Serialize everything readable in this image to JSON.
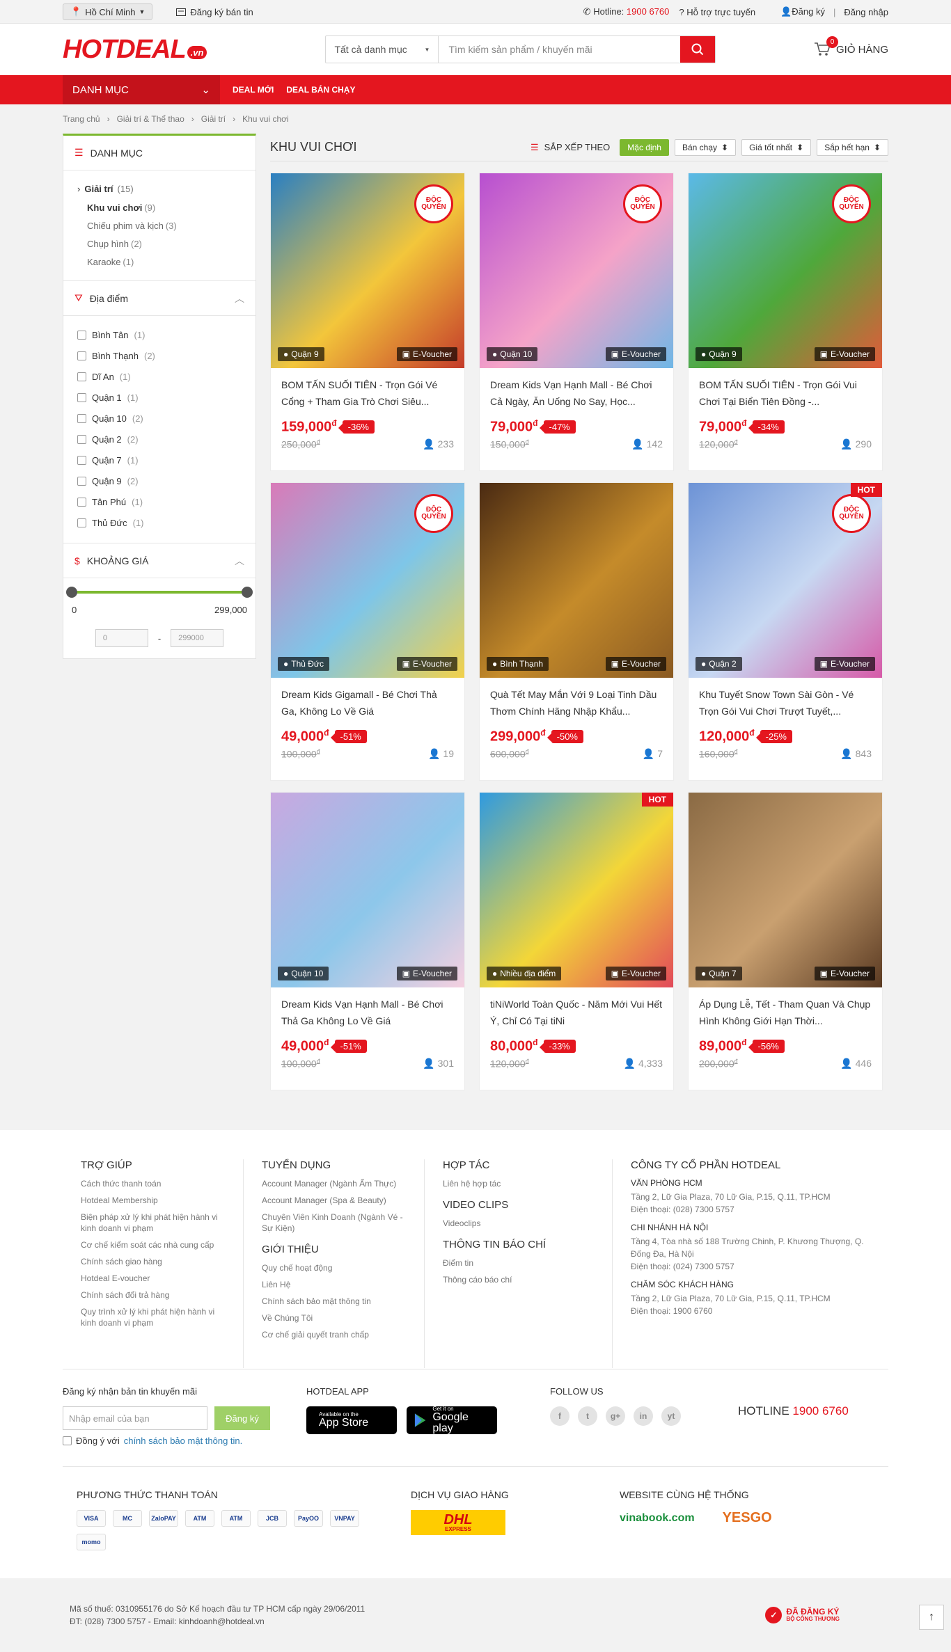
{
  "topbar": {
    "city": "Hồ Chí Minh",
    "register_seller": "Đăng ký bán tin",
    "hotline_label": "Hotline:",
    "hotline_number": "1900 6760",
    "online_support": "Hỗ trợ trực tuyến",
    "register": "Đăng ký",
    "separator": "|",
    "login": "Đăng nhập"
  },
  "header": {
    "logo": "HOTDEAL",
    "logo_suffix": ".vn",
    "category_select": "Tất cả danh mục",
    "search_placeholder": "Tìm kiếm sản phẩm / khuyến mãi",
    "cart_label": "GIỎ HÀNG",
    "cart_count": "0"
  },
  "nav": {
    "category_label": "DANH MỤC",
    "items": [
      "DEAL MỚI",
      "DEAL BÁN CHẠY"
    ]
  },
  "breadcrumb": [
    "Trang chủ",
    "Giải trí & Thể thao",
    "Giải trí",
    "Khu vui chơi"
  ],
  "sidebar": {
    "categories_title": "DANH MỤC",
    "top_category": {
      "label": "Giải trí",
      "count": "(15)"
    },
    "sub_categories": [
      {
        "label": "Khu vui chơi",
        "count": "(9)"
      },
      {
        "label": "Chiếu phim và kịch",
        "count": "(3)"
      },
      {
        "label": "Chụp hình",
        "count": "(2)"
      },
      {
        "label": "Karaoke",
        "count": "(1)"
      }
    ],
    "location_title": "Địa điểm",
    "locations": [
      {
        "label": "Bình Tân",
        "count": "(1)"
      },
      {
        "label": "Bình Thạnh",
        "count": "(2)"
      },
      {
        "label": "Dĩ An",
        "count": "(1)"
      },
      {
        "label": "Quận 1",
        "count": "(1)"
      },
      {
        "label": "Quận 10",
        "count": "(2)"
      },
      {
        "label": "Quận 2",
        "count": "(2)"
      },
      {
        "label": "Quận 7",
        "count": "(1)"
      },
      {
        "label": "Quận 9",
        "count": "(2)"
      },
      {
        "label": "Tân Phú",
        "count": "(1)"
      },
      {
        "label": "Thủ Đức",
        "count": "(1)"
      }
    ],
    "price_title": "KHOẢNG GIÁ",
    "price_min": "0",
    "price_max": "299,000",
    "input_min": "0",
    "input_dash": "-",
    "input_max": "299000"
  },
  "content": {
    "title": "KHU VUI CHƠI",
    "sort_label": "SẮP XẾP THEO",
    "sort_options": [
      "Mặc định",
      "Bán chạy",
      "Giá tốt nhất",
      "Sắp hết hạn"
    ]
  },
  "products": [
    {
      "title": "BOM TẤN SUỐI TIÊN - Trọn Gói Vé Cổng + Tham Gia Trò Chơi Siêu...",
      "price": "159,000",
      "discount": "-36%",
      "old_price": "250,000",
      "sold": "233",
      "location": "Quận 9",
      "voucher": "E-Voucher",
      "badge": "ĐỘC QUYỀN",
      "hot": "",
      "img_colors": [
        "#2a7fc2",
        "#f3c63b",
        "#c43b2a"
      ]
    },
    {
      "title": "Dream Kids Vạn Hạnh Mall - Bé Chơi Cả Ngày, Ăn Uống No Say, Học...",
      "price": "79,000",
      "discount": "-47%",
      "old_price": "150,000",
      "sold": "142",
      "location": "Quận 10",
      "voucher": "E-Voucher",
      "badge": "ĐỘC QUYỀN",
      "hot": "",
      "img_colors": [
        "#b74fd0",
        "#f5a3c8",
        "#6fb7e6"
      ]
    },
    {
      "title": "BOM TẤN SUỐI TIÊN - Trọn Gói Vui Chơi Tại Biển Tiên Đồng -...",
      "price": "79,000",
      "discount": "-34%",
      "old_price": "120,000",
      "sold": "290",
      "location": "Quận 9",
      "voucher": "E-Voucher",
      "badge": "ĐỘC QUYỀN",
      "hot": "",
      "img_colors": [
        "#5bb9e8",
        "#4fa83b",
        "#e25a3a"
      ]
    },
    {
      "title": "Dream Kids Gigamall - Bé Chơi Thả Ga, Không Lo Về Giá",
      "price": "49,000",
      "discount": "-51%",
      "old_price": "100,000",
      "sold": "19",
      "location": "Thủ Đức",
      "voucher": "E-Voucher",
      "badge": "ĐỘC QUYỀN",
      "hot": "",
      "img_colors": [
        "#d97ab8",
        "#7ec6e8",
        "#f2d14a"
      ]
    },
    {
      "title": "Quà Tết May Mắn Với 9 Loại Tinh Dầu Thơm Chính Hãng Nhập Khẩu...",
      "price": "299,000",
      "discount": "-50%",
      "old_price": "600,000",
      "sold": "7",
      "location": "Bình Thạnh",
      "voucher": "E-Voucher",
      "badge": "",
      "hot": "",
      "img_colors": [
        "#4a2a12",
        "#c58b2a",
        "#8a5a22"
      ]
    },
    {
      "title": "Khu Tuyết Snow Town Sài Gòn - Vé Trọn Gói Vui Chơi Trượt Tuyết,...",
      "price": "120,000",
      "discount": "-25%",
      "old_price": "160,000",
      "sold": "843",
      "location": "Quận 2",
      "voucher": "E-Voucher",
      "badge": "ĐỘC QUYỀN",
      "hot": "HOT",
      "img_colors": [
        "#6d93d6",
        "#c7d8f2",
        "#d65aa8"
      ]
    },
    {
      "title": "Dream Kids Vạn Hạnh Mall - Bé Chơi Thả Ga Không Lo Về Giá",
      "price": "49,000",
      "discount": "-51%",
      "old_price": "100,000",
      "sold": "301",
      "location": "Quận 10",
      "voucher": "E-Voucher",
      "badge": "",
      "hot": "",
      "img_colors": [
        "#c9a8e0",
        "#8dc7ea",
        "#f5d0e0"
      ]
    },
    {
      "title": "tiNiWorld Toàn Quốc - Năm Mới Vui Hết Ý, Chỉ Có Tại tiNi",
      "price": "80,000",
      "discount": "-33%",
      "old_price": "120,000",
      "sold": "4,333",
      "location": "Nhiều địa điểm",
      "voucher": "E-Voucher",
      "badge": "",
      "hot": "HOT",
      "img_colors": [
        "#2f9ae0",
        "#f3d638",
        "#e24a5a"
      ]
    },
    {
      "title": "Áp Dụng Lễ, Tết - Tham Quan Và Chụp Hình Không Giới Hạn Thời...",
      "price": "89,000",
      "discount": "-56%",
      "old_price": "200,000",
      "sold": "446",
      "location": "Quận 7",
      "voucher": "E-Voucher",
      "badge": "",
      "hot": "",
      "img_colors": [
        "#8a6a44",
        "#c9a070",
        "#5a3a22"
      ]
    }
  ],
  "footer": {
    "help": {
      "title": "TRỢ GIÚP",
      "links": [
        "Cách thức thanh toán",
        "Hotdeal Membership",
        "Biện pháp xử lý khi phát hiện hành vi kinh doanh vi phạm",
        "Cơ chế kiểm soát các nhà cung cấp",
        "Chính sách giao hàng",
        "Hotdeal E-voucher",
        "Chính sách đổi trả hàng",
        "Quy trình xử lý khi phát hiện hành vi kinh doanh vi phạm"
      ]
    },
    "jobs": {
      "title": "TUYỂN DỤNG",
      "links": [
        "Account Manager (Ngành Ẩm Thực)",
        "Account Manager (Spa & Beauty)",
        "Chuyên Viên Kinh Doanh (Ngành Vé - Sự Kiện)"
      ]
    },
    "about": {
      "title": "GIỚI THIỆU",
      "links": [
        "Quy chế hoạt động",
        "Liên Hệ",
        "Chính sách bảo mật thông tin",
        "Về Chúng Tôi",
        "Cơ chế giải quyết tranh chấp"
      ]
    },
    "partner": {
      "title": "HỢP TÁC",
      "links": [
        "Liên hệ hợp tác"
      ]
    },
    "video": {
      "title": "VIDEO CLIPS",
      "links": [
        "Videoclips"
      ]
    },
    "press": {
      "title": "THÔNG TIN BÁO CHÍ",
      "links": [
        "Điểm tin",
        "Thông cáo báo chí"
      ]
    },
    "company": {
      "title": "CÔNG TY CỔ PHẦN HOTDEAL",
      "offices": [
        {
          "name": "VĂN PHÒNG HCM",
          "address": "Tầng 2, Lữ Gia Plaza, 70 Lữ Gia, P.15, Q.11, TP.HCM",
          "phone": "Điện thoại: (028) 7300 5757"
        },
        {
          "name": "CHI NHÁNH HÀ NỘI",
          "address": "Tầng 4, Tòa nhà số 188 Trường Chinh, P. Khương Thượng, Q. Đống Đa, Hà Nội",
          "phone": "Điện thoại: (024) 7300 5757"
        },
        {
          "name": "CHĂM SÓC KHÁCH HÀNG",
          "address": "Tầng 2, Lữ Gia Plaza, 70 Lữ Gia, P.15, Q.11, TP.HCM",
          "phone": "Điện thoại: 1900 6760"
        }
      ]
    },
    "newsletter": {
      "title": "Đăng ký nhận bản tin khuyến mãi",
      "placeholder": "Nhập email của bạn",
      "button": "Đăng ký",
      "agree_prefix": "Đồng ý với",
      "agree_link": "chính sách bảo mật thông tin."
    },
    "app": {
      "title": "HOTDEAL APP",
      "appstore_small": "Available on the",
      "appstore": "App Store",
      "gplay_small": "Get it on",
      "gplay": "Google play"
    },
    "follow": {
      "title": "FOLLOW US",
      "icons": [
        "f",
        "t",
        "g+",
        "in",
        "yt"
      ]
    },
    "hotline_label": "HOTLINE",
    "hotline": "1900 6760",
    "payment_title": "PHƯƠNG THỨC THANH TOÁN",
    "payment_methods": [
      "VISA",
      "MC",
      "ZaloPAY",
      "ATM",
      "ATM",
      "JCB",
      "PayOO",
      "VNPAY",
      "momo"
    ],
    "shipping_title": "DỊCH VỤ GIAO HÀNG",
    "shipping_logo": "DHL",
    "shipping_sub": "EXPRESS",
    "sites_title": "WEBSITE CÙNG HỆ THỐNG",
    "sites": [
      "vinabook.com",
      "YESGO"
    ],
    "tax": "Mã số thuế: 0310955176 do Sở Kế hoạch đầu tư TP HCM cấp ngày 29/06/2011",
    "contact": "ĐT: (028) 7300 5757 - Email: kinhdoanh@hotdeal.vn",
    "registered": "ĐÃ ĐĂNG KÝ",
    "registered_sub": "BỘ CÔNG THƯƠNG"
  }
}
